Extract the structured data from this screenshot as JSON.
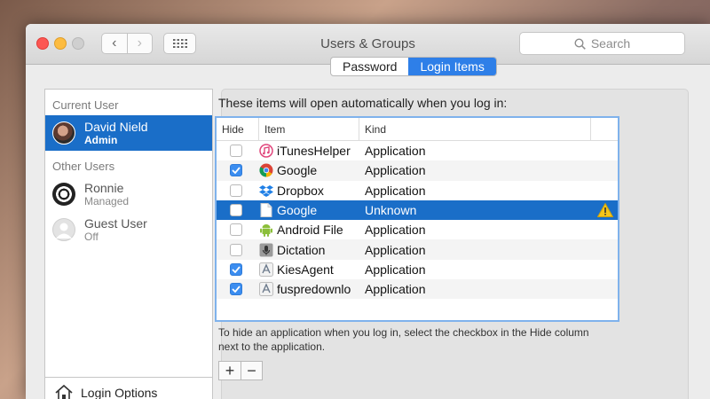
{
  "window": {
    "title": "Users & Groups"
  },
  "search": {
    "placeholder": "Search"
  },
  "tabs": [
    {
      "label": "Password",
      "active": false
    },
    {
      "label": "Login Items",
      "active": true
    }
  ],
  "sidebar": {
    "current_user_header": "Current User",
    "other_users_header": "Other Users",
    "users": [
      {
        "name": "David Nield",
        "role": "Admin",
        "selected": true,
        "avatar": "photo-avatar"
      },
      {
        "name": "Ronnie",
        "role": "Managed",
        "selected": false,
        "avatar": "soccer-ball-avatar"
      },
      {
        "name": "Guest User",
        "role": "Off",
        "selected": false,
        "avatar": "guest-avatar"
      }
    ],
    "login_options": "Login Options"
  },
  "login_items": {
    "intro": "These items will open automatically when you log in:",
    "columns": [
      "Hide",
      "Item",
      "Kind"
    ],
    "rows": [
      {
        "hide": false,
        "item": "iTunesHelper",
        "kind": "Application",
        "icon": "itunes-icon"
      },
      {
        "hide": true,
        "item": "Google",
        "kind": "Application",
        "icon": "chrome-icon"
      },
      {
        "hide": false,
        "item": "Dropbox",
        "kind": "Application",
        "icon": "dropbox-icon"
      },
      {
        "hide": false,
        "item": "Google",
        "kind": "Unknown",
        "icon": "document-icon",
        "selected": true,
        "warning": true
      },
      {
        "hide": false,
        "item": "Android File",
        "kind": "Application",
        "icon": "android-icon"
      },
      {
        "hide": false,
        "item": "Dictation",
        "kind": "Application",
        "icon": "dictation-icon"
      },
      {
        "hide": true,
        "item": "KiesAgent",
        "kind": "Application",
        "icon": "app-generic-icon"
      },
      {
        "hide": true,
        "item": "fuspredownlo",
        "kind": "Application",
        "icon": "app-generic-icon"
      }
    ],
    "help_text": "To hide an application when you log in, select the checkbox in the Hide column next to the application.",
    "add_label": "+",
    "remove_label": "−"
  },
  "colors": {
    "selection": "#1a6ec8",
    "checkbox_on": "#3b8df0",
    "close": "#fc5753",
    "minimize": "#fdbc40",
    "warning": "#f5c518"
  }
}
